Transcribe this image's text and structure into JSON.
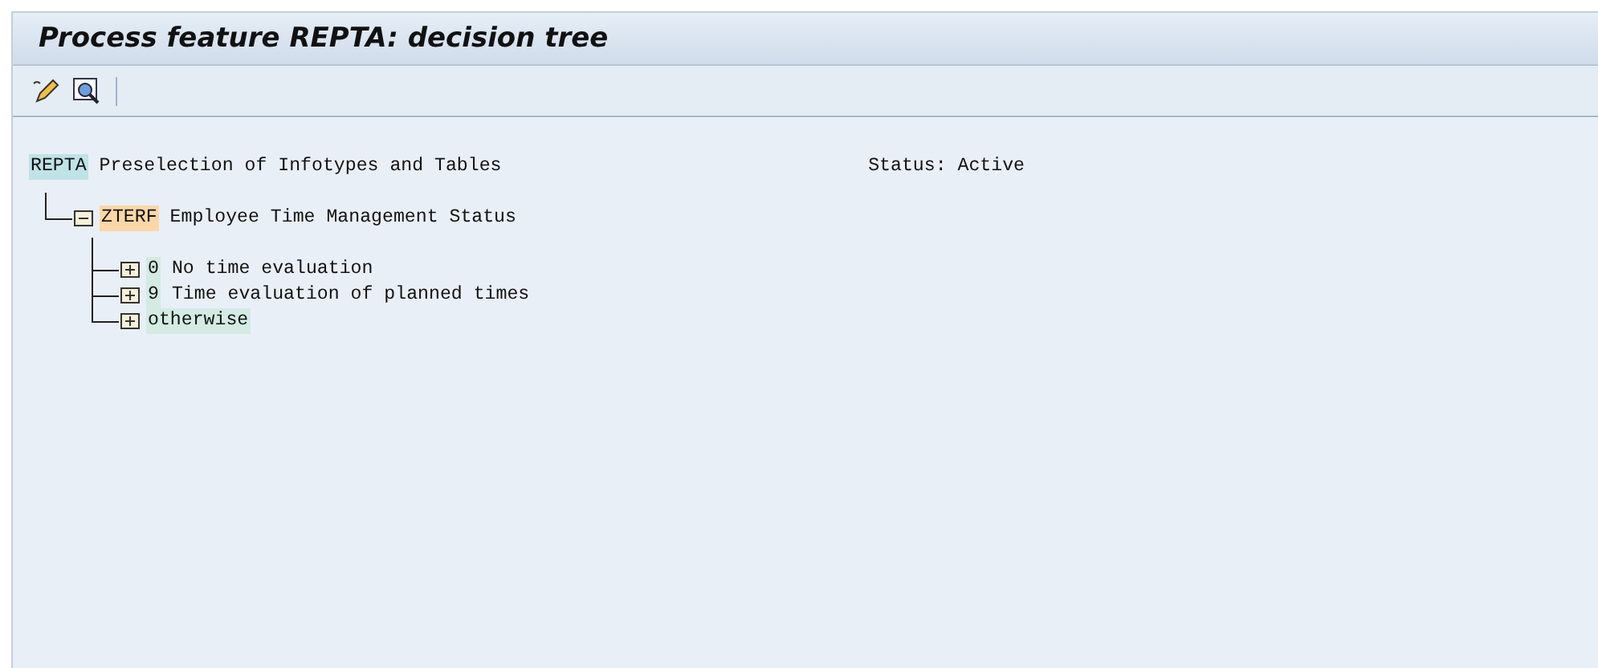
{
  "window": {
    "title": "Process feature REPTA: decision tree"
  },
  "toolbar": {
    "buttons": [
      {
        "kind": "edit"
      },
      {
        "kind": "inspect"
      }
    ]
  },
  "tree": {
    "key": "REPTA",
    "text": "Preselection of Infotypes and Tables",
    "status": "Status: Active",
    "children": [
      {
        "key": "ZTERF",
        "text": "Employee Time Management Status",
        "expanded": true,
        "children": [
          {
            "key": "0",
            "text": "No time evaluation",
            "expanded": false
          },
          {
            "key": "9",
            "text": "Time evaluation of planned times",
            "expanded": false
          },
          {
            "key": "otherwise",
            "expanded": false
          }
        ]
      }
    ]
  }
}
